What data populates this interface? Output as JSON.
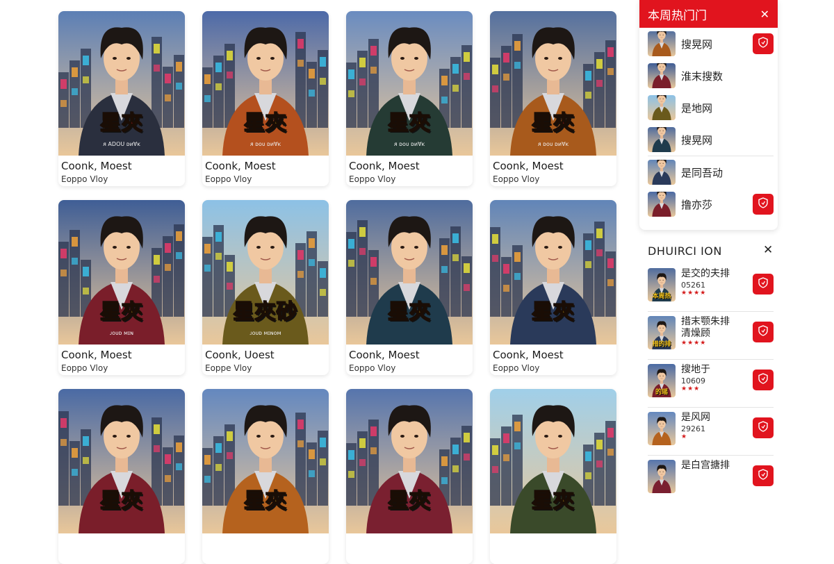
{
  "cards": [
    {
      "poster_title": "星夾",
      "poster_sub": "ᴙ ADOU ᴅᴎⱯᴋ",
      "title": "Coonk, Moest",
      "subtitle": "Eoppo Vloy",
      "accent": "#e8222a"
    },
    {
      "poster_title": "星夾",
      "poster_sub": "ᴙ ᴅᴏᴜ ᴅᴎⱯᴋ",
      "title": "Coonk, Moest",
      "subtitle": "Eoppo Vloy",
      "accent": "#f2c21b"
    },
    {
      "poster_title": "星夾",
      "poster_sub": "ᴙ ᴅᴏᴜ ᴅᴎⱯᴋ",
      "title": "Coonk, Moest",
      "subtitle": "Eoppo Vloy",
      "accent": "#f2c21b"
    },
    {
      "poster_title": "星夾",
      "poster_sub": "ᴙ ᴅᴏᴜ ᴅᴎⱯᴋ",
      "title": "Coonk, Moest",
      "subtitle": "Eoppo Vloy",
      "accent": "#e8222a"
    },
    {
      "poster_title": "星夾",
      "poster_sub": "ᴊᴏᴜᴅ ᴍɪɴ",
      "title": "Coonk, Moest",
      "subtitle": "Eoppo Vloy",
      "accent": "#f2c21b"
    },
    {
      "poster_title": "星夾砂",
      "poster_sub": "ᴊᴏᴜᴅ ᴍɪɴᴏᴍ",
      "title": "Coonk, Uoest",
      "subtitle": "Eoppe Vloy",
      "accent": "#f2c21b"
    },
    {
      "poster_title": "星夾",
      "poster_sub": "",
      "title": "Coonk, Moest",
      "subtitle": "Eoppo Vloy",
      "accent": "#f2c21b"
    },
    {
      "poster_title": "星夾",
      "poster_sub": "",
      "title": "Coonk, Moest",
      "subtitle": "Eoppo Vloy",
      "accent": "#f2c21b"
    },
    {
      "poster_title": "星夾",
      "poster_sub": "",
      "title": "",
      "subtitle": "",
      "accent": "#e8222a"
    },
    {
      "poster_title": "星夾",
      "poster_sub": "",
      "title": "",
      "subtitle": "",
      "accent": "#f2c21b"
    },
    {
      "poster_title": "星夾",
      "poster_sub": "",
      "title": "",
      "subtitle": "",
      "accent": "#e8222a"
    },
    {
      "poster_title": "星夾",
      "poster_sub": "",
      "title": "",
      "subtitle": "",
      "accent": "#f2c21b"
    }
  ],
  "hot_panel": {
    "title": "本周热门门",
    "items": [
      {
        "label": "搜晃网",
        "has_button": true
      },
      {
        "label": "淮末搜数",
        "has_button": false
      },
      {
        "label": "是地网",
        "has_button": false
      },
      {
        "label": "搜晃网",
        "has_button": false
      },
      {
        "label": "是同吾动",
        "has_button": false
      },
      {
        "label": "撸亦莎",
        "has_button": true
      }
    ]
  },
  "ranking": {
    "title": "DHUIRCI ION",
    "items": [
      {
        "title": "是交的夫排",
        "count": "05261",
        "stars": "★★★★",
        "thumb_text": "本周热"
      },
      {
        "title": "措末颚朱排",
        "title2": "清燥顾",
        "count": "",
        "stars": "★★★★",
        "thumb_text": "措的排"
      },
      {
        "title": "搜地于",
        "count": "10609",
        "stars": "★★★",
        "thumb_text": "的瑶"
      },
      {
        "title": "是风网",
        "count": "29261",
        "stars": "★",
        "thumb_text": ""
      },
      {
        "title": "是白宫搪排",
        "count": "",
        "stars": "",
        "thumb_text": ""
      }
    ]
  },
  "colors": {
    "brand_red": "#e1141e"
  }
}
